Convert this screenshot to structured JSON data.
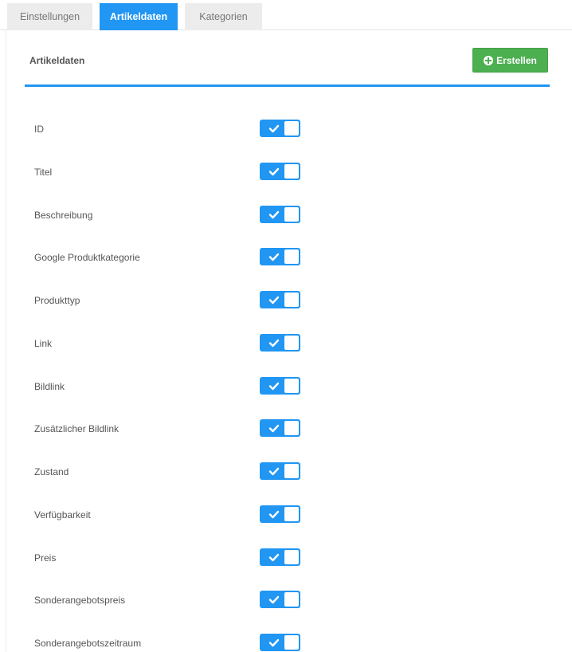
{
  "tabs": [
    {
      "label": "Einstellungen",
      "active": false
    },
    {
      "label": "Artikeldaten",
      "active": true
    },
    {
      "label": "Kategorien",
      "active": false
    }
  ],
  "panel": {
    "title": "Artikeldaten",
    "create_label": "Erstellen",
    "create_icon": "plus-circle-icon"
  },
  "fields": [
    {
      "label": "ID",
      "enabled": true
    },
    {
      "label": "Titel",
      "enabled": true
    },
    {
      "label": "Beschreibung",
      "enabled": true
    },
    {
      "label": "Google Produktkategorie",
      "enabled": true
    },
    {
      "label": "Produkttyp",
      "enabled": true
    },
    {
      "label": "Link",
      "enabled": true
    },
    {
      "label": "Bildlink",
      "enabled": true
    },
    {
      "label": "Zusätzlicher Bildlink",
      "enabled": true
    },
    {
      "label": "Zustand",
      "enabled": true
    },
    {
      "label": "Verfügbarkeit",
      "enabled": true
    },
    {
      "label": "Preis",
      "enabled": true
    },
    {
      "label": "Sonderangebotspreis",
      "enabled": true
    },
    {
      "label": "Sonderangebotszeitraum",
      "enabled": true
    }
  ],
  "colors": {
    "accent": "#2196f3",
    "success": "#4caf50",
    "tab_inactive": "#ececec"
  }
}
